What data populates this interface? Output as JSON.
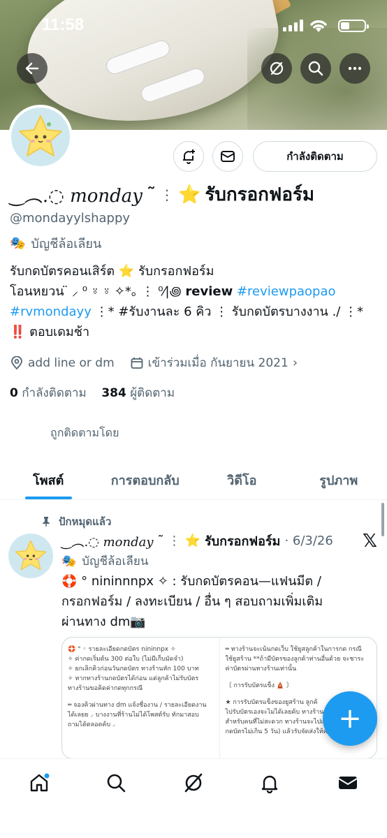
{
  "status_bar": {
    "time": "11:58"
  },
  "header": {
    "back_icon": "back-arrow-icon",
    "grok_icon": "slash-circle-icon",
    "search_icon": "search-icon",
    "more_icon": "more-icon"
  },
  "profile": {
    "follow_button": "กำลังติดตาม",
    "name_deco": "‿︵.◌ monday",
    "name_mark": "˜",
    "name_emoji": "⭐",
    "name_text": "รับกรอกฟอร์ม",
    "handle": "@mondayylshappy",
    "parody_label": "บัญชีล้อเลียน",
    "bio": {
      "line1": "รับกดบัตรคอนเสิร์ต ⭐ รับกรอกฟอร์ม",
      "line2_a": "โอนหยวน  ̈ ⸝ ⁰ ⍤ ⍤ ✧*｡  ⋮  ⁰⁄|꩜",
      "line2_bold": "review",
      "line2_link": "#reviewpaopao",
      "line3_link": "#rvmondayy",
      "line3_rest": " ⋮*  #รับงานละ 6 คิว ⋮ รับกดบัตรบางงาน ./  ⋮*",
      "line4": "‼️ ตอบเดมช้า"
    },
    "location": "add line or dm",
    "joined": "เข้าร่วมเมื่อ กันยายน 2021",
    "following_count": "0",
    "following_label": "กำลังติดตาม",
    "followers_count": "384",
    "followers_label": "ผู้ติดตาม",
    "followed_by": "ถูกติดตามโดย"
  },
  "tabs": [
    {
      "label": "โพสต์",
      "active": true
    },
    {
      "label": "การตอบกลับ",
      "active": false
    },
    {
      "label": "วิดีโอ",
      "active": false
    },
    {
      "label": "รูปภาพ",
      "active": false
    }
  ],
  "post": {
    "pinned_label": "ปักหมุดแล้ว",
    "author_deco": "‿︵.◌ monday",
    "author_mark": "˜",
    "author_emoji": "⭐",
    "author_text": "รับกรอกฟอร์ม",
    "date": "· 6/3/26",
    "parody_label": "บัญชีล้อเลียน",
    "text_line1": "🛟 ° nininnnpx ✧ : รับกดบัตรคอน—แฟนมีต /",
    "text_line2": "กรอกฟอร์ม / ลงทะเบียน / อื่น ๆ  สอบถามเพิ่มเติม",
    "text_line3": "ผ่านทาง dm📷",
    "media_left": [
      "🛟 ° ◦ รายละเอียดกดบัตร nininnpx ✧",
      "✧ ค่ากดเริ่มต้น 300 ต่อใบ (ไม่มีเก็บมัดจำ)",
      "✧ ยกเลิกคิวก่อนวันกดบัตร ทางร้านหัก 100 บาท",
      "✧ หากทางร้านกดบัตรได้ก่อน แต่ลูกค้าไม่รับบัตร",
      "ทางร้านขอคิดค่ากดทุกกรณี",
      "",
      "═ จองคิวผ่านทาง dm แจ้งชื่องาน / รายละเอียดงาน",
      "ได้เลยย ⸝ บางงานที่ร้านไม่ได้โพสต์รับ ทักมาสอบ",
      "ถามได้ตลอดค้บ ⸝"
    ],
    "media_right": [
      "═ ทางร้านจะเน้นกดเว็บ ใช้ยูสลูกค้าในการกด กรณี",
      "ใช้ยูสร้าน **ถ้ามีบัตรของลูกค้าท่านอื่นด้วย จะชาระ",
      "ค่าบัตรผ่านทางร้านเท่านั้น",
      "",
      "〔 การรับบัตรแข็ง 🛕 〕",
      "",
      "★ การรับบัตรแข็งของยูสร้าน ลูกค้",
      "ไปรับบัตรเองจะไม่ได้เลยค้บ ทางร้าน",
      "สำหรับคนที่ไม่สะดวก ทางร้านจะไปเอ",
      "กดบัตรไม่เกิน 5 วัน) แล้วรับจัดส่งให้คับ"
    ]
  },
  "fab_label": "+",
  "bottom_nav": [
    "home-icon",
    "search-icon",
    "grok-icon",
    "notifications-icon",
    "messages-icon"
  ]
}
